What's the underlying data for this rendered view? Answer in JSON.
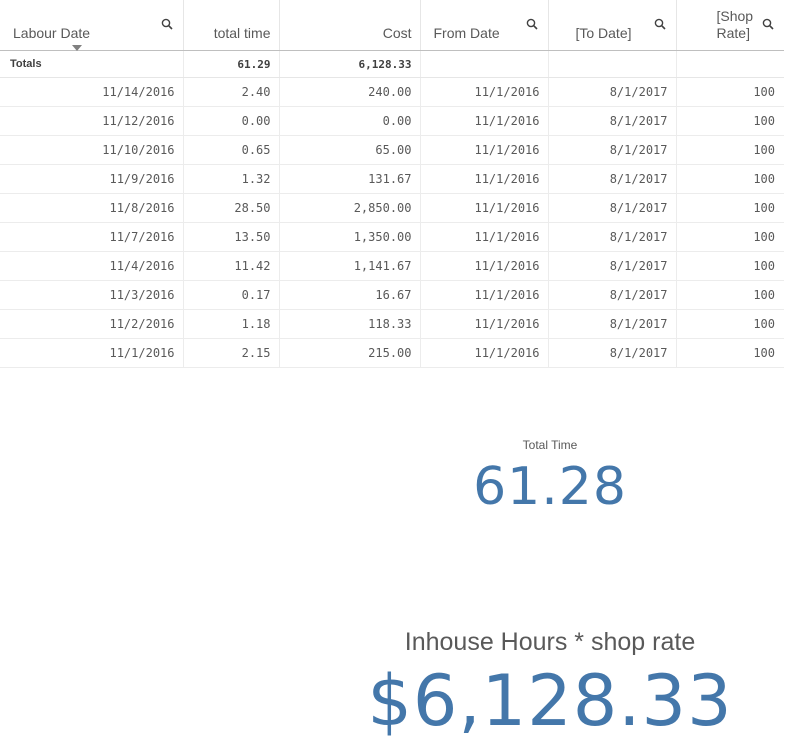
{
  "table": {
    "headers": [
      {
        "label": "Labour Date",
        "search": true
      },
      {
        "label": "total time",
        "search": false
      },
      {
        "label": "Cost",
        "search": false
      },
      {
        "label": "From Date",
        "search": true
      },
      {
        "label": "[To Date]",
        "search": true
      },
      {
        "label": "[Shop Rate]",
        "search": true
      }
    ],
    "totals": {
      "label": "Totals",
      "total_time": "61.29",
      "cost": "6,128.33"
    },
    "rows": [
      [
        "11/14/2016",
        "2.40",
        "240.00",
        "11/1/2016",
        "8/1/2017",
        "100"
      ],
      [
        "11/12/2016",
        "0.00",
        "0.00",
        "11/1/2016",
        "8/1/2017",
        "100"
      ],
      [
        "11/10/2016",
        "0.65",
        "65.00",
        "11/1/2016",
        "8/1/2017",
        "100"
      ],
      [
        "11/9/2016",
        "1.32",
        "131.67",
        "11/1/2016",
        "8/1/2017",
        "100"
      ],
      [
        "11/8/2016",
        "28.50",
        "2,850.00",
        "11/1/2016",
        "8/1/2017",
        "100"
      ],
      [
        "11/7/2016",
        "13.50",
        "1,350.00",
        "11/1/2016",
        "8/1/2017",
        "100"
      ],
      [
        "11/4/2016",
        "11.42",
        "1,141.67",
        "11/1/2016",
        "8/1/2017",
        "100"
      ],
      [
        "11/3/2016",
        "0.17",
        "16.67",
        "11/1/2016",
        "8/1/2017",
        "100"
      ],
      [
        "11/2/2016",
        "1.18",
        "118.33",
        "11/1/2016",
        "8/1/2017",
        "100"
      ],
      [
        "11/1/2016",
        "2.15",
        "215.00",
        "11/1/2016",
        "8/1/2017",
        "100"
      ]
    ]
  },
  "kpi_total_time": {
    "label": "Total Time",
    "value": "61.28"
  },
  "kpi_cost": {
    "label": "Inhouse Hours * shop rate",
    "value": "$6,128.33"
  },
  "colors": {
    "kpi_value": "#4477aa",
    "text": "#595959"
  },
  "icons": {
    "search": "search-icon",
    "sort": "sort-descending-indicator"
  }
}
